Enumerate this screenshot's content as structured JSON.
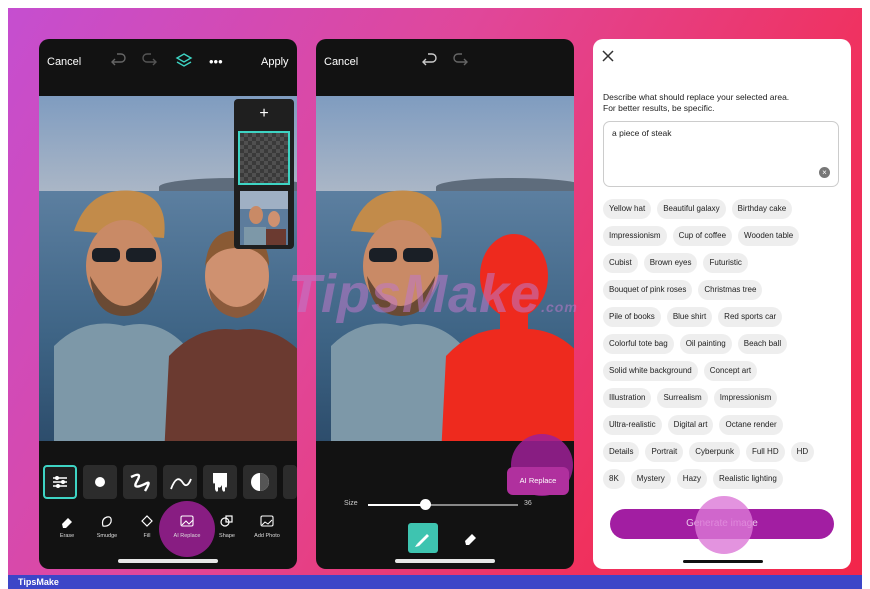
{
  "phone1": {
    "cancel": "Cancel",
    "apply": "Apply",
    "more": "•••",
    "layers_add": "+",
    "tabs": [
      "Erase",
      "Smudge",
      "Fill",
      "AI Replace",
      "Shape",
      "Add Photo"
    ]
  },
  "phone2": {
    "cancel": "Cancel",
    "size_label": "Size",
    "size_value": "36",
    "size_fraction": 0.38,
    "ai_replace": "AI Replace"
  },
  "panel": {
    "instructions_line1": "Describe what should replace your selected area.",
    "instructions_line2": "For better results, be specific.",
    "prompt_value": "a piece of steak",
    "suggestion_rows": [
      [
        "Yellow hat",
        "Beautiful galaxy",
        "Birthday cake"
      ],
      [
        "Impressionism",
        "Cup of coffee",
        "Wooden table"
      ],
      [
        "Cubist",
        "Brown eyes",
        "Futuristic"
      ],
      [
        "Bouquet of pink roses",
        "Christmas tree"
      ],
      [
        "Pile of books",
        "Blue shirt",
        "Red sports car"
      ],
      [
        "Colorful tote bag",
        "Oil painting",
        "Beach ball"
      ],
      [
        "Solid white background",
        "Concept art"
      ],
      [
        "Illustration",
        "Surrealism",
        "Impressionism"
      ],
      [
        "Ultra-realistic",
        "Digital art",
        "Octane render"
      ],
      [
        "Details",
        "Portrait",
        "Cyberpunk",
        "Full HD",
        "HD"
      ],
      [
        "8K",
        "Mystery",
        "Hazy",
        "Realistic lighting"
      ]
    ],
    "generate": "Generate image"
  },
  "watermark": {
    "main": "TipsMake",
    "suffix": ".com"
  },
  "footer": {
    "brand": "TipsMake"
  },
  "colors": {
    "accent": "#a21ea2",
    "teal": "#3ed4c4",
    "mask_red": "#f0281e"
  }
}
